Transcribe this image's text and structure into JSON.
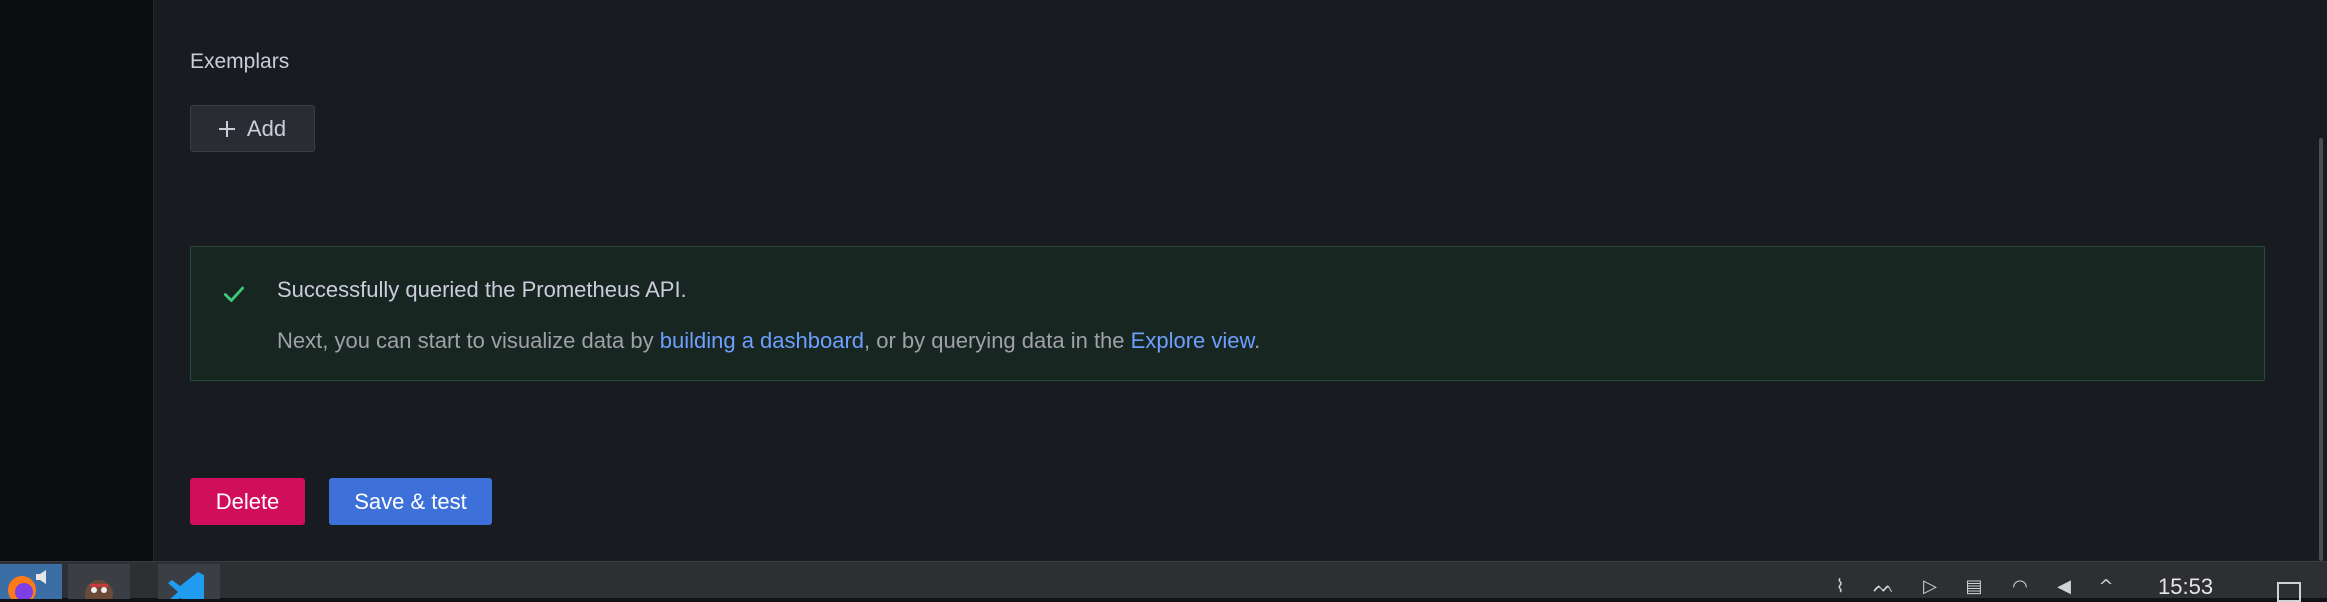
{
  "exemplars": {
    "label": "Exemplars",
    "add_label": "Add"
  },
  "alert": {
    "title": "Successfully queried the Prometheus API.",
    "body_prefix": "Next, you can start to visualize data by ",
    "link_dashboard": "building a dashboard",
    "body_middle": ", or by querying data in the ",
    "link_explore": "Explore view",
    "body_suffix": "."
  },
  "actions": {
    "delete_label": "Delete",
    "save_label": "Save & test"
  },
  "taskbar": {
    "clock": "15:53",
    "apps": [
      "firefox-icon",
      "app-icon",
      "vscode-icon"
    ],
    "tray": [
      "network-activity-icon",
      "flame-icon",
      "media-icon",
      "clipboard-icon",
      "wifi-icon",
      "volume-icon",
      "chevron-up-icon"
    ]
  },
  "colors": {
    "delete": "#d10e5c",
    "save": "#3d71d9",
    "link": "#6e9fff",
    "success": "#3ec97a"
  }
}
